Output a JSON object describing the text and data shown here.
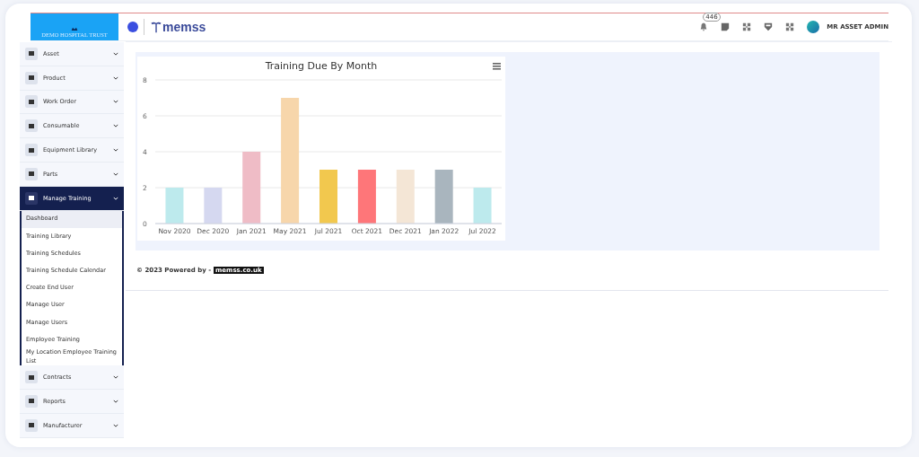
{
  "header": {
    "organisation": "DEMO HOSPITAL TRUST",
    "logo": "memss",
    "notification_count": "446",
    "user": "MR ASSET ADMIN"
  },
  "sidebar": {
    "items": [
      {
        "label": "Asset",
        "expanded": false
      },
      {
        "label": "Product",
        "expanded": false
      },
      {
        "label": "Work Order",
        "expanded": false
      },
      {
        "label": "Consumable",
        "expanded": false
      },
      {
        "label": "Equipment Library",
        "expanded": false
      },
      {
        "label": "Parts",
        "expanded": false
      },
      {
        "label": "Manage Training",
        "expanded": true,
        "children": [
          {
            "label": "Dashboard",
            "selected": true
          },
          {
            "label": "Training Library",
            "selected": false
          },
          {
            "label": "Training Schedules",
            "selected": false
          },
          {
            "label": "Training Schedule Calendar",
            "selected": false
          },
          {
            "label": "Create End User",
            "selected": false
          },
          {
            "label": "Manage User",
            "selected": false
          },
          {
            "label": "Manage Users",
            "selected": false
          },
          {
            "label": "Employee Training",
            "selected": false
          },
          {
            "label": "My Location Employee Training List",
            "selected": false
          }
        ]
      },
      {
        "label": "Contracts",
        "expanded": false
      },
      {
        "label": "Reports",
        "expanded": false
      },
      {
        "label": "Manufacturer",
        "expanded": false
      }
    ]
  },
  "chart": {
    "chart_data": {
      "type": "bar",
      "title": "Training Due By Month",
      "categories": [
        "Nov 2020",
        "Dec 2020",
        "Jan 2021",
        "May 2021",
        "Jul 2021",
        "Oct 2021",
        "Dec 2021",
        "Jan 2022",
        "Jul 2022"
      ],
      "ylim": [
        0,
        8
      ],
      "grid": true,
      "yticks": [
        0,
        2,
        4,
        6,
        8
      ],
      "series": [
        {
          "values": [
            2,
            2,
            4,
            7,
            3,
            3,
            3,
            3,
            2
          ],
          "colors": [
            "#bdeaed",
            "#d5d8f0",
            "#efbcc6",
            "#f7d6ab",
            "#f2c84e",
            "#fe7679",
            "#f4e6d6",
            "#a9b5be",
            "#bdeaed"
          ]
        }
      ]
    }
  },
  "footer": {
    "text": "© 2023 Powered by -",
    "link": "memss.co.uk"
  }
}
